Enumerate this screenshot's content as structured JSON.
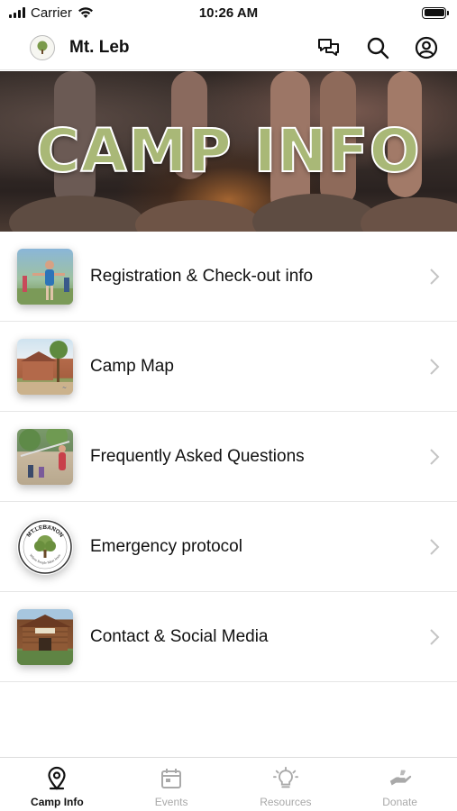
{
  "status_bar": {
    "carrier": "Carrier",
    "time": "10:26 AM"
  },
  "header": {
    "title": "Mt. Leb",
    "icons": [
      "chat-bubbles-icon",
      "search-icon",
      "account-icon"
    ]
  },
  "hero": {
    "title": "CAMP INFO"
  },
  "list": {
    "items": [
      {
        "label": "Registration & Check-out info",
        "thumbnail": "registration-photo"
      },
      {
        "label": "Camp Map",
        "thumbnail": "camp-map-photo"
      },
      {
        "label": "Frequently Asked Questions",
        "thumbnail": "faq-photo"
      },
      {
        "label": "Emergency protocol",
        "thumbnail": "mt-lebanon-logo",
        "logo_text_top": "MT.LEBANON",
        "logo_text_bottom": "Where People Meet Jesus"
      },
      {
        "label": "Contact & Social Media",
        "thumbnail": "contact-photo"
      }
    ]
  },
  "tab_bar": {
    "tabs": [
      {
        "label": "Camp Info",
        "icon": "map-pin-icon",
        "active": true
      },
      {
        "label": "Events",
        "icon": "calendar-icon",
        "active": false
      },
      {
        "label": "Resources",
        "icon": "lightbulb-icon",
        "active": false
      },
      {
        "label": "Donate",
        "icon": "donate-hand-icon",
        "active": false
      }
    ]
  },
  "colors": {
    "hero_title": "#a9b877",
    "active_tab": "#111111",
    "inactive_tab": "#a9a9a9",
    "divider": "#e6e6e6"
  }
}
